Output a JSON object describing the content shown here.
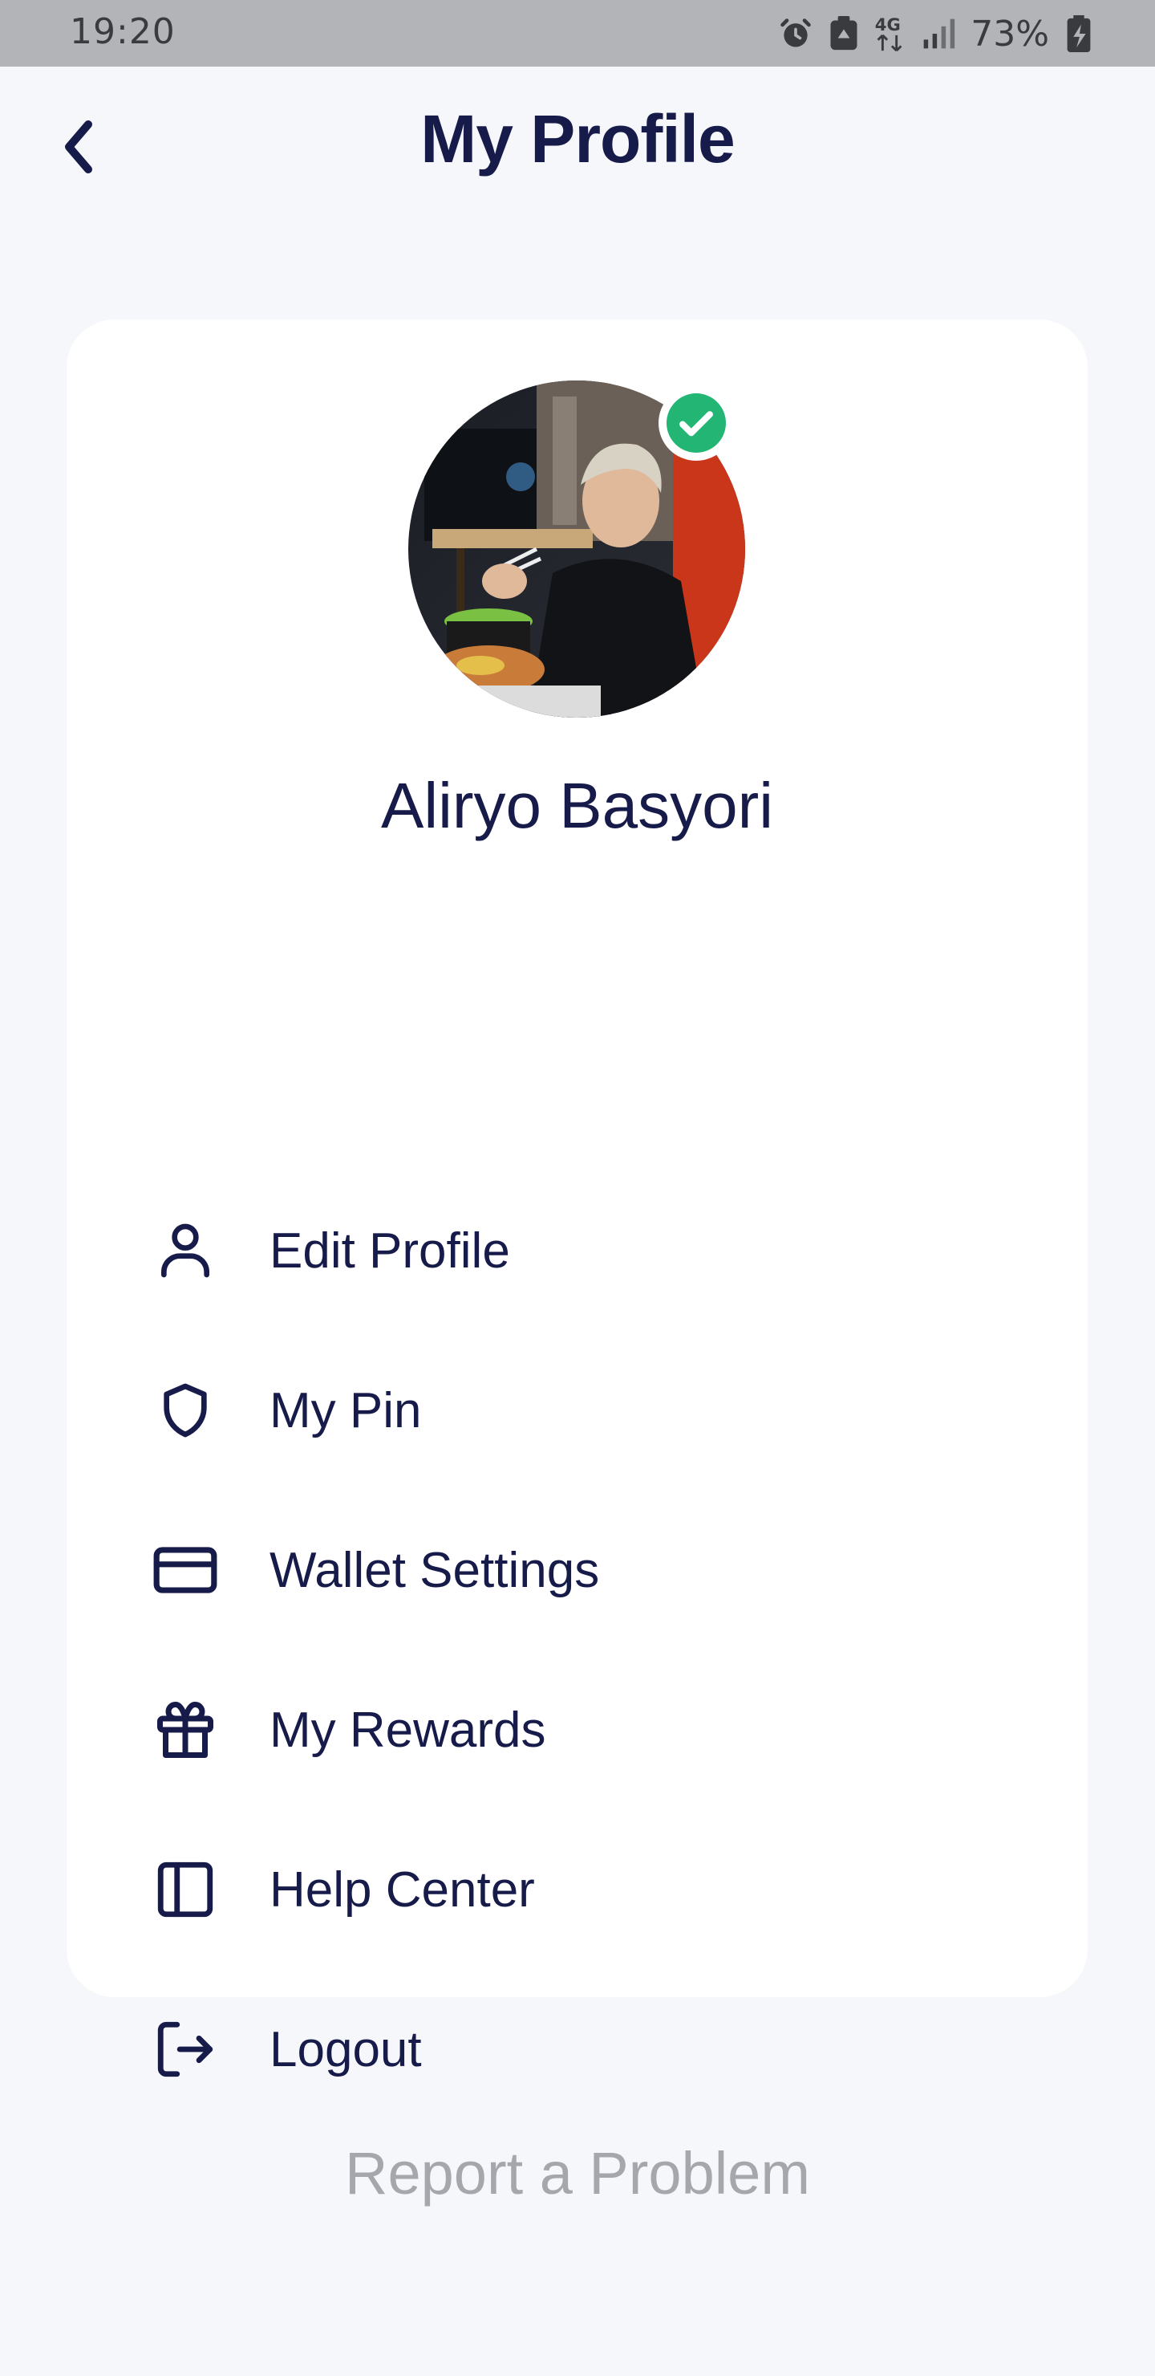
{
  "status_bar": {
    "time": "19:20",
    "network": "4G",
    "battery": "73%"
  },
  "header": {
    "title": "My Profile",
    "back_icon": "chevron-left-icon"
  },
  "profile": {
    "name": "Aliryo Basyori",
    "verified": true,
    "verified_color": "#22b573"
  },
  "menu": [
    {
      "label": "Edit Profile",
      "icon": "user-icon"
    },
    {
      "label": "My Pin",
      "icon": "shield-icon"
    },
    {
      "label": "Wallet Settings",
      "icon": "credit-card-icon"
    },
    {
      "label": "My Rewards",
      "icon": "gift-icon"
    },
    {
      "label": "Help Center",
      "icon": "sidebar-panel-icon"
    },
    {
      "label": "Logout",
      "icon": "logout-icon"
    }
  ],
  "footer": {
    "report_label": "Report a Problem"
  },
  "colors": {
    "background": "#f6f7fb",
    "card": "#ffffff",
    "text_primary": "#171b4a",
    "text_muted": "#a6a7ad",
    "status_bar": "#b3b4b8"
  }
}
